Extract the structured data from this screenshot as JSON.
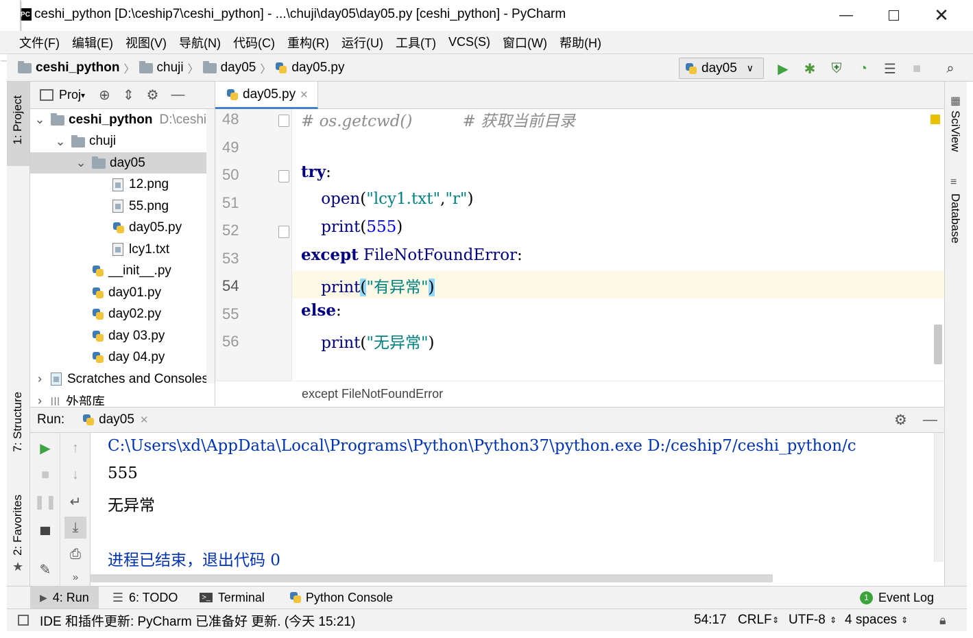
{
  "window": {
    "title": "ceshi_python [D:\\ceship7\\ceshi_python] - ...\\chuji\\day05\\day05.py [ceshi_python] - PyCharm",
    "app_icon": "PC"
  },
  "menu": [
    "文件(F)",
    "编辑(E)",
    "视图(V)",
    "导航(N)",
    "代码(C)",
    "重构(R)",
    "运行(U)",
    "工具(T)",
    "VCS(S)",
    "窗口(W)",
    "帮助(H)"
  ],
  "nav": {
    "crumbs": [
      "ceshi_python",
      "chuji",
      "day05",
      "day05.py"
    ],
    "run_config": "day05"
  },
  "left_stripe": {
    "project": "1: Project",
    "structure": "7: Structure",
    "favorites": "2: Favorites"
  },
  "right_stripe": {
    "sciview": "SciView",
    "database": "Database"
  },
  "project": {
    "header": "Proj",
    "tree": [
      {
        "label": "ceshi_python",
        "hint": "D:\\ceship",
        "kind": "folder",
        "level": 0,
        "arrow": "down",
        "bold": true
      },
      {
        "label": "chuji",
        "kind": "folder",
        "level": 1,
        "arrow": "down"
      },
      {
        "label": "day05",
        "kind": "folder",
        "level": 2,
        "arrow": "down",
        "selected": true
      },
      {
        "label": "12.png",
        "kind": "img",
        "level": 3
      },
      {
        "label": "55.png",
        "kind": "img",
        "level": 3
      },
      {
        "label": "day05.py",
        "kind": "py",
        "level": 3
      },
      {
        "label": "lcy1.txt",
        "kind": "txt",
        "level": 3
      },
      {
        "label": "__init__.py",
        "kind": "py",
        "level": 2
      },
      {
        "label": "day01.py",
        "kind": "py",
        "level": 2
      },
      {
        "label": "day02.py",
        "kind": "py",
        "level": 2
      },
      {
        "label": "day 03.py",
        "kind": "py",
        "level": 2
      },
      {
        "label": "day 04.py",
        "kind": "py",
        "level": 2
      },
      {
        "label": "Scratches and Consoles",
        "kind": "scratch",
        "level": 0,
        "arrow": "right"
      },
      {
        "label": "外部库",
        "kind": "lib",
        "level": 0,
        "arrow": "right"
      }
    ]
  },
  "editor": {
    "tab": "day05.py",
    "line_numbers": [
      "48",
      "49",
      "50",
      "51",
      "52",
      "53",
      "54",
      "55",
      "56"
    ],
    "breadcrumb": "except FileNotFoundError",
    "cursor": "54:17"
  },
  "run": {
    "label": "Run:",
    "tab": "day05",
    "output": [
      "C:\\Users\\xd\\AppData\\Local\\Programs\\Python\\Python37\\python.exe D:/ceship7/ceshi_python/c",
      "555",
      "无异常",
      "",
      "进程已结束，退出代码 0"
    ]
  },
  "toolwindows": {
    "run": "4: Run",
    "todo": "6: TODO",
    "terminal": "Terminal",
    "python_console": "Python Console",
    "event_log": "Event Log",
    "event_count": "1"
  },
  "status": {
    "message": "IDE 和插件更新: PyCharm 已准备好 更新. (今天 15:21)",
    "position": "54:17",
    "line_sep": "CRLF",
    "encoding": "UTF-8",
    "indent": "4 spaces"
  }
}
